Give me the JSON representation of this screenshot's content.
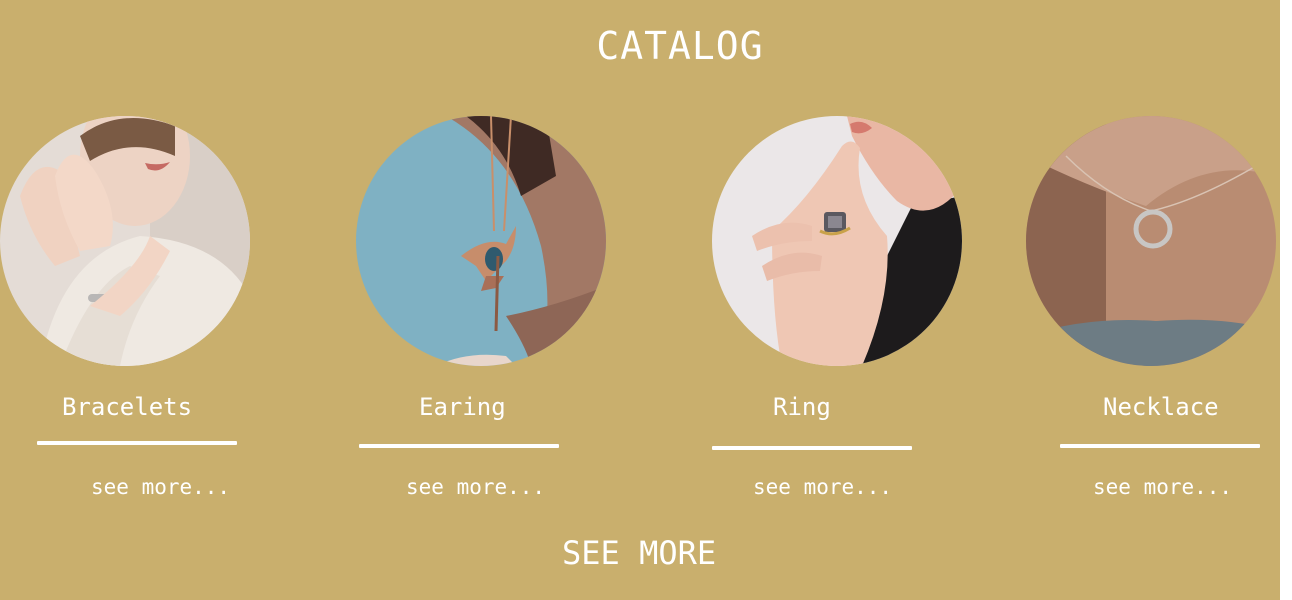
{
  "header": {
    "title": "CATALOG"
  },
  "items": [
    {
      "label": "Bracelets",
      "link": "see more...",
      "image": "woman-with-bracelet-photo"
    },
    {
      "label": "Earing",
      "link": "see more...",
      "image": "hummingbird-pendant-photo"
    },
    {
      "label": "Ring",
      "link": "see more...",
      "image": "hand-with-ring-photo"
    },
    {
      "label": "Necklace",
      "link": "see more...",
      "image": "circle-necklace-photo"
    }
  ],
  "footer": {
    "see_more": "SEE MORE"
  },
  "colors": {
    "background": "#c9af6d",
    "text": "#ffffff"
  }
}
